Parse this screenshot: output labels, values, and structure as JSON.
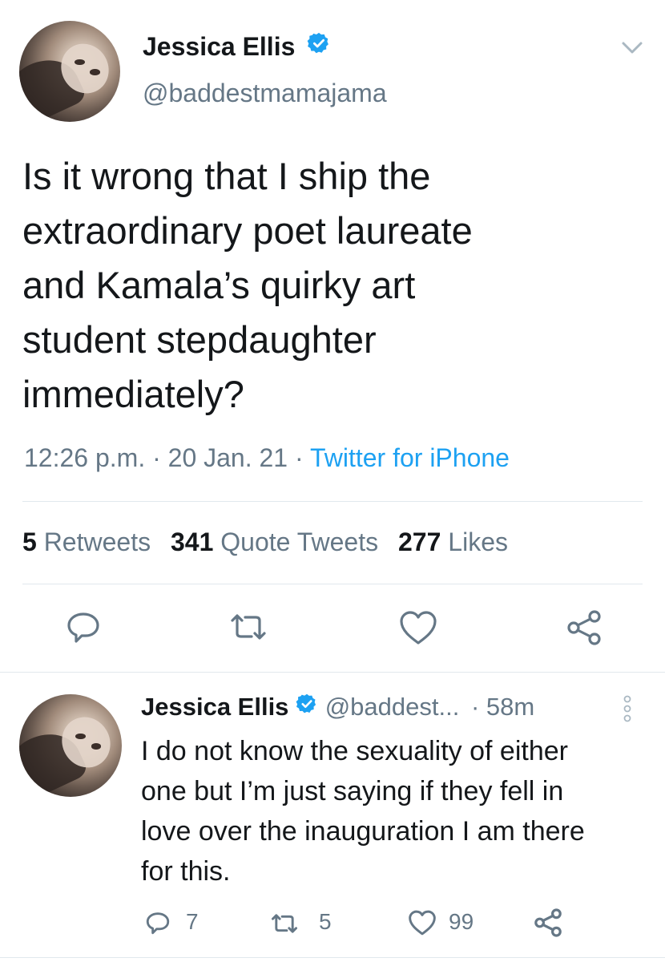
{
  "tweet": {
    "author_name": "Jessica Ellis",
    "handle": "@baddestmamajama",
    "text_lines": [
      "Is it wrong that I ship the",
      "extraordinary  poet laureate",
      "and Kamala’s quirky art",
      "student stepdaughter",
      "immediately?"
    ],
    "time": "12:26 p.m.",
    "date": "20 Jan. 21",
    "source": "Twitter for iPhone",
    "sep": "·",
    "stats": {
      "retweets_count": "5",
      "retweets_label": "Retweets",
      "quotes_count": "341",
      "quotes_label": "Quote Tweets",
      "likes_count": "277",
      "likes_label": "Likes"
    },
    "actions": [
      "reply-icon",
      "retweet-icon",
      "like-icon",
      "share-icon"
    ]
  },
  "reply": {
    "author_name": "Jessica Ellis",
    "handle": "@baddest...",
    "sep": "·",
    "time": "58m",
    "text_lines": [
      "I do not know the sexuality of either",
      "one but I’m just saying if they fell in",
      "love over the inauguration I am there",
      "for this."
    ],
    "reply_count": "7",
    "retweet_count": "5",
    "like_count": "99"
  },
  "colors": {
    "accent": "#1da1f2",
    "text": "#14171a",
    "muted": "#657786",
    "divider": "#e1e8ed"
  }
}
